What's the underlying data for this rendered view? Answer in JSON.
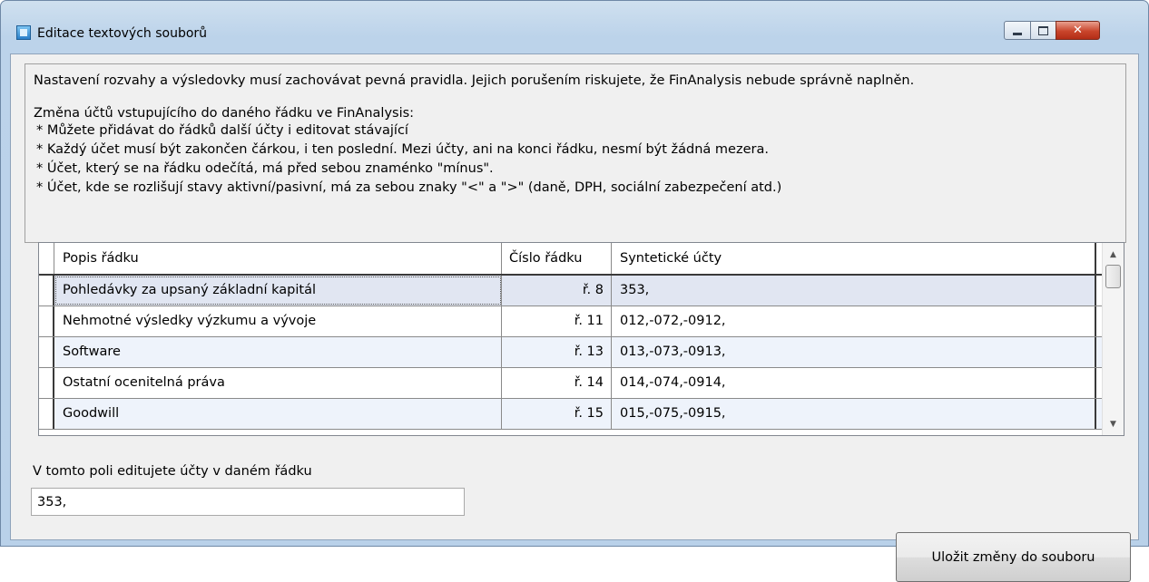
{
  "window": {
    "title": "Editace textových souborů"
  },
  "info": {
    "intro": "Nastavení rozvahy a výsledovky musí zachovávat pevná pravidla. Jejich porušením riskujete, že FinAnalysis nebude správně naplněn.",
    "heading": "Změna účtů vstupujícího do daného řádku ve FinAnalysis:",
    "rules": [
      "* Můžete přidávat do řádků další účty i editovat stávající",
      "* Každý účet musí být zakončen čárkou, i ten poslední. Mezi účty, ani na konci řádku, nesmí být žádná mezera.",
      "* Účet, který se na řádku odečítá, má před sebou znaménko \"mínus\".",
      "* Účet, kde se rozlišují stavy aktivní/pasivní, má za sebou znaky \"<\" a \">\" (daně, DPH, sociální zabezpečení atd.)"
    ]
  },
  "grid": {
    "columns": [
      "Popis řádku",
      "Číslo řádku",
      "Syntetické účty"
    ],
    "rows": [
      {
        "popis": "Pohledávky za upsaný základní kapitál",
        "cislo": "ř. 8",
        "ucty": "353,"
      },
      {
        "popis": "Nehmotné výsledky výzkumu a vývoje",
        "cislo": "ř. 11",
        "ucty": "012,-072,-0912,"
      },
      {
        "popis": "Software",
        "cislo": "ř. 13",
        "ucty": "013,-073,-0913,"
      },
      {
        "popis": "Ostatní ocenitelná práva",
        "cislo": "ř. 14",
        "ucty": "014,-074,-0914,"
      },
      {
        "popis": "Goodwill",
        "cislo": "ř. 15",
        "ucty": "015,-075,-0915,"
      }
    ],
    "selected_row": 0
  },
  "editor": {
    "label": "V tomto poli editujete účty v daném řádku",
    "value": "353,"
  },
  "buttons": {
    "save_label": "Uložit změny do souboru"
  },
  "icons": {
    "minimize": "minimize-icon",
    "maximize": "maximize-icon",
    "close": "close-icon",
    "scroll_up": "scroll-up-icon",
    "scroll_down": "scroll-down-icon"
  }
}
